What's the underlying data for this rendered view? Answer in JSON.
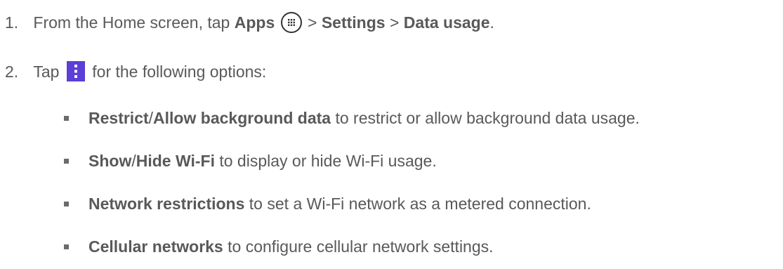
{
  "step1": {
    "number": "1.",
    "text_a": "From the Home screen, tap ",
    "apps": "Apps",
    "sep1": " > ",
    "settings": "Settings",
    "sep2": " > ",
    "data_usage": "Data usage",
    "end": ".",
    "icon": "apps-grid-icon"
  },
  "step2": {
    "number": "2.",
    "text_a": "Tap ",
    "text_b": " for the following options:",
    "icon": "menu-more-vert-icon",
    "icon_color": "#5b3fd6"
  },
  "options": [
    {
      "bold_a": "Restrict",
      "slash": "/",
      "bold_b": "Allow background data",
      "desc": " to restrict or allow background data usage."
    },
    {
      "bold_a": "Show",
      "slash": "/",
      "bold_b": "Hide Wi-Fi",
      "desc": " to display or hide Wi-Fi usage."
    },
    {
      "bold_a": "Network restrictions",
      "desc": " to set a Wi-Fi network as a metered connection."
    },
    {
      "bold_a": "Cellular networks",
      "desc": " to configure cellular network settings."
    }
  ]
}
